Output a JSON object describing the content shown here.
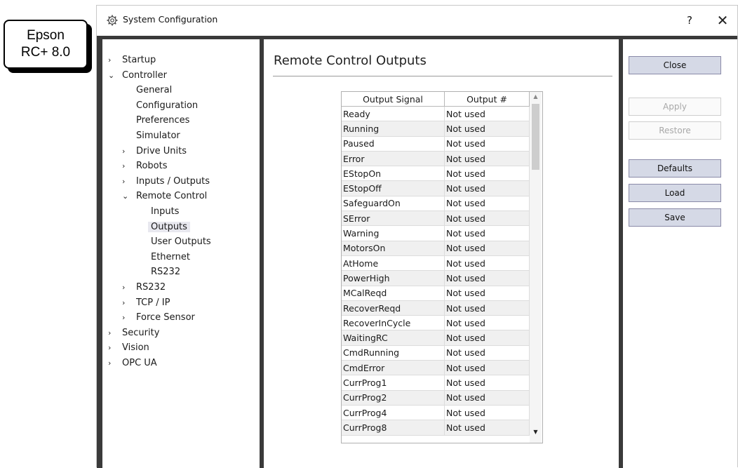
{
  "badge": {
    "line1": "Epson",
    "line2": "RC+ 8.0"
  },
  "window": {
    "title": "System Configuration",
    "help": "?",
    "close": "✕"
  },
  "tree": [
    {
      "label": "Startup",
      "chev": "›",
      "indent": 0
    },
    {
      "label": "Controller",
      "chev": "⌄",
      "indent": 0
    },
    {
      "label": "General",
      "chev": "",
      "indent": 1
    },
    {
      "label": "Configuration",
      "chev": "",
      "indent": 1
    },
    {
      "label": "Preferences",
      "chev": "",
      "indent": 1
    },
    {
      "label": "Simulator",
      "chev": "",
      "indent": 1
    },
    {
      "label": "Drive Units",
      "chev": "›",
      "indent": 1
    },
    {
      "label": "Robots",
      "chev": "›",
      "indent": 1
    },
    {
      "label": "Inputs / Outputs",
      "chev": "›",
      "indent": 1
    },
    {
      "label": "Remote Control",
      "chev": "⌄",
      "indent": 1
    },
    {
      "label": "Inputs",
      "chev": "",
      "indent": 2
    },
    {
      "label": "Outputs",
      "chev": "",
      "indent": 2,
      "selected": true
    },
    {
      "label": "User Outputs",
      "chev": "",
      "indent": 2
    },
    {
      "label": "Ethernet",
      "chev": "",
      "indent": 2
    },
    {
      "label": "RS232",
      "chev": "",
      "indent": 2
    },
    {
      "label": "RS232",
      "chev": "›",
      "indent": 1
    },
    {
      "label": "TCP / IP",
      "chev": "›",
      "indent": 1
    },
    {
      "label": "Force Sensor",
      "chev": "›",
      "indent": 1
    },
    {
      "label": "Security",
      "chev": "›",
      "indent": 0
    },
    {
      "label": "Vision",
      "chev": "›",
      "indent": 0
    },
    {
      "label": "OPC UA",
      "chev": "›",
      "indent": 0
    }
  ],
  "content": {
    "heading": "Remote Control Outputs",
    "columns": [
      "Output Signal",
      "Output #"
    ],
    "rows": [
      [
        "Ready",
        "Not used"
      ],
      [
        "Running",
        "Not used"
      ],
      [
        "Paused",
        "Not used"
      ],
      [
        "Error",
        "Not used"
      ],
      [
        "EStopOn",
        "Not used"
      ],
      [
        "EStopOff",
        "Not used"
      ],
      [
        "SafeguardOn",
        "Not used"
      ],
      [
        "SError",
        "Not used"
      ],
      [
        "Warning",
        "Not used"
      ],
      [
        "MotorsOn",
        "Not used"
      ],
      [
        "AtHome",
        "Not used"
      ],
      [
        "PowerHigh",
        "Not used"
      ],
      [
        "MCalReqd",
        "Not used"
      ],
      [
        "RecoverReqd",
        "Not used"
      ],
      [
        "RecoverInCycle",
        "Not used"
      ],
      [
        "WaitingRC",
        "Not used"
      ],
      [
        "CmdRunning",
        "Not used"
      ],
      [
        "CmdError",
        "Not used"
      ],
      [
        "CurrProg1",
        "Not used"
      ],
      [
        "CurrProg2",
        "Not used"
      ],
      [
        "CurrProg4",
        "Not used"
      ],
      [
        "CurrProg8",
        "Not used"
      ]
    ]
  },
  "buttons": [
    {
      "id": "close",
      "label": "Close",
      "enabled": true
    },
    {
      "id": "apply",
      "label": "Apply",
      "enabled": false
    },
    {
      "id": "restore",
      "label": "Restore",
      "enabled": false
    },
    {
      "id": "defaults",
      "label": "Defaults",
      "enabled": true
    },
    {
      "id": "load",
      "label": "Load",
      "enabled": true
    },
    {
      "id": "save",
      "label": "Save",
      "enabled": true
    }
  ]
}
